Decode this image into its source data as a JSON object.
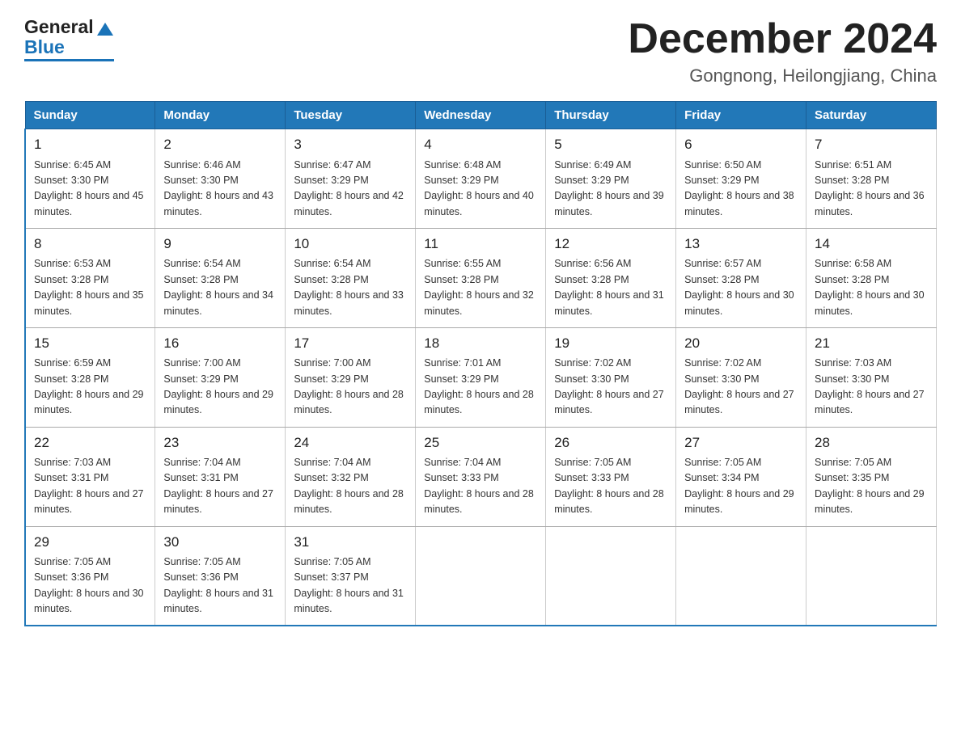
{
  "header": {
    "logo_general": "General",
    "logo_blue": "Blue",
    "month_title": "December 2024",
    "location": "Gongnong, Heilongjiang, China"
  },
  "weekdays": [
    "Sunday",
    "Monday",
    "Tuesday",
    "Wednesday",
    "Thursday",
    "Friday",
    "Saturday"
  ],
  "weeks": [
    [
      {
        "day": "1",
        "sunrise": "6:45 AM",
        "sunset": "3:30 PM",
        "daylight": "8 hours and 45 minutes."
      },
      {
        "day": "2",
        "sunrise": "6:46 AM",
        "sunset": "3:30 PM",
        "daylight": "8 hours and 43 minutes."
      },
      {
        "day": "3",
        "sunrise": "6:47 AM",
        "sunset": "3:29 PM",
        "daylight": "8 hours and 42 minutes."
      },
      {
        "day": "4",
        "sunrise": "6:48 AM",
        "sunset": "3:29 PM",
        "daylight": "8 hours and 40 minutes."
      },
      {
        "day": "5",
        "sunrise": "6:49 AM",
        "sunset": "3:29 PM",
        "daylight": "8 hours and 39 minutes."
      },
      {
        "day": "6",
        "sunrise": "6:50 AM",
        "sunset": "3:29 PM",
        "daylight": "8 hours and 38 minutes."
      },
      {
        "day": "7",
        "sunrise": "6:51 AM",
        "sunset": "3:28 PM",
        "daylight": "8 hours and 36 minutes."
      }
    ],
    [
      {
        "day": "8",
        "sunrise": "6:53 AM",
        "sunset": "3:28 PM",
        "daylight": "8 hours and 35 minutes."
      },
      {
        "day": "9",
        "sunrise": "6:54 AM",
        "sunset": "3:28 PM",
        "daylight": "8 hours and 34 minutes."
      },
      {
        "day": "10",
        "sunrise": "6:54 AM",
        "sunset": "3:28 PM",
        "daylight": "8 hours and 33 minutes."
      },
      {
        "day": "11",
        "sunrise": "6:55 AM",
        "sunset": "3:28 PM",
        "daylight": "8 hours and 32 minutes."
      },
      {
        "day": "12",
        "sunrise": "6:56 AM",
        "sunset": "3:28 PM",
        "daylight": "8 hours and 31 minutes."
      },
      {
        "day": "13",
        "sunrise": "6:57 AM",
        "sunset": "3:28 PM",
        "daylight": "8 hours and 30 minutes."
      },
      {
        "day": "14",
        "sunrise": "6:58 AM",
        "sunset": "3:28 PM",
        "daylight": "8 hours and 30 minutes."
      }
    ],
    [
      {
        "day": "15",
        "sunrise": "6:59 AM",
        "sunset": "3:28 PM",
        "daylight": "8 hours and 29 minutes."
      },
      {
        "day": "16",
        "sunrise": "7:00 AM",
        "sunset": "3:29 PM",
        "daylight": "8 hours and 29 minutes."
      },
      {
        "day": "17",
        "sunrise": "7:00 AM",
        "sunset": "3:29 PM",
        "daylight": "8 hours and 28 minutes."
      },
      {
        "day": "18",
        "sunrise": "7:01 AM",
        "sunset": "3:29 PM",
        "daylight": "8 hours and 28 minutes."
      },
      {
        "day": "19",
        "sunrise": "7:02 AM",
        "sunset": "3:30 PM",
        "daylight": "8 hours and 27 minutes."
      },
      {
        "day": "20",
        "sunrise": "7:02 AM",
        "sunset": "3:30 PM",
        "daylight": "8 hours and 27 minutes."
      },
      {
        "day": "21",
        "sunrise": "7:03 AM",
        "sunset": "3:30 PM",
        "daylight": "8 hours and 27 minutes."
      }
    ],
    [
      {
        "day": "22",
        "sunrise": "7:03 AM",
        "sunset": "3:31 PM",
        "daylight": "8 hours and 27 minutes."
      },
      {
        "day": "23",
        "sunrise": "7:04 AM",
        "sunset": "3:31 PM",
        "daylight": "8 hours and 27 minutes."
      },
      {
        "day": "24",
        "sunrise": "7:04 AM",
        "sunset": "3:32 PM",
        "daylight": "8 hours and 28 minutes."
      },
      {
        "day": "25",
        "sunrise": "7:04 AM",
        "sunset": "3:33 PM",
        "daylight": "8 hours and 28 minutes."
      },
      {
        "day": "26",
        "sunrise": "7:05 AM",
        "sunset": "3:33 PM",
        "daylight": "8 hours and 28 minutes."
      },
      {
        "day": "27",
        "sunrise": "7:05 AM",
        "sunset": "3:34 PM",
        "daylight": "8 hours and 29 minutes."
      },
      {
        "day": "28",
        "sunrise": "7:05 AM",
        "sunset": "3:35 PM",
        "daylight": "8 hours and 29 minutes."
      }
    ],
    [
      {
        "day": "29",
        "sunrise": "7:05 AM",
        "sunset": "3:36 PM",
        "daylight": "8 hours and 30 minutes."
      },
      {
        "day": "30",
        "sunrise": "7:05 AM",
        "sunset": "3:36 PM",
        "daylight": "8 hours and 31 minutes."
      },
      {
        "day": "31",
        "sunrise": "7:05 AM",
        "sunset": "3:37 PM",
        "daylight": "8 hours and 31 minutes."
      },
      null,
      null,
      null,
      null
    ]
  ]
}
